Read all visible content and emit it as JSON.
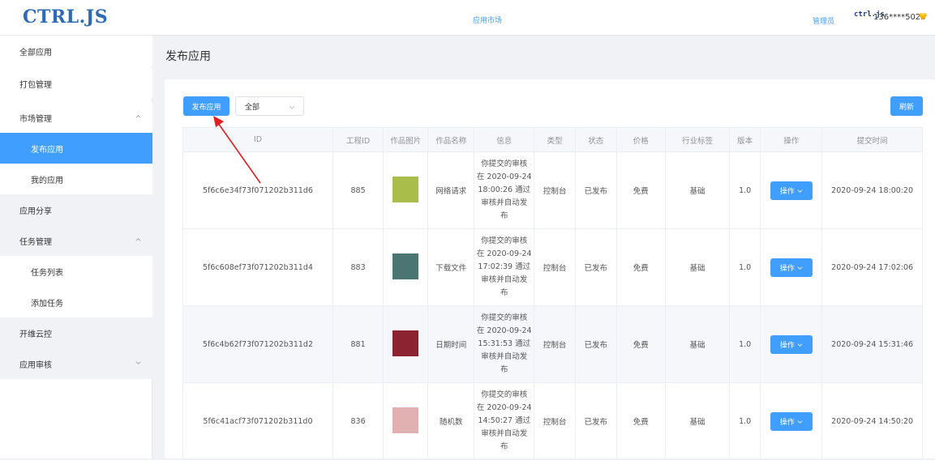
{
  "header": {
    "logo": "CTRL.JS",
    "nav_market": "应用市场",
    "admin": "管理员",
    "user_logo": "ctrl.js",
    "user_phone": "136****5023"
  },
  "icons": {
    "gem": "gem-icon",
    "chevron": "chevron-icon"
  },
  "colors": {
    "primary": "#409eff",
    "logo": "#2d6bb5",
    "arrow": "#e02020"
  },
  "sidebar": {
    "items": [
      {
        "label": "全部应用"
      },
      {
        "label": "打包管理"
      },
      {
        "label": "市场管理"
      },
      {
        "label": "发布应用"
      },
      {
        "label": "我的应用"
      },
      {
        "label": "应用分享"
      },
      {
        "label": "任务管理"
      },
      {
        "label": "任务列表"
      },
      {
        "label": "添加任务"
      },
      {
        "label": "开维云控"
      },
      {
        "label": "应用审核"
      }
    ]
  },
  "main": {
    "title": "发布应用",
    "publish_btn": "发布应用",
    "filter_value": "全部",
    "refresh_btn": "刷新"
  },
  "table": {
    "headers": [
      "ID",
      "工程ID",
      "作品图片",
      "作品名称",
      "信息",
      "类型",
      "状态",
      "价格",
      "行业标签",
      "版本",
      "操作",
      "提交时间"
    ],
    "rows": [
      {
        "id": "5f6c6e34f73f071202b311d6",
        "project_id": "885",
        "thumb_color": "#a8bd4a",
        "name": "网络请求",
        "info": [
          "你提交的审核",
          "在 2020-09-24",
          "18:00:26 通过",
          "审核并自动发",
          "布"
        ],
        "type": "控制台",
        "status": "已发布",
        "price": "免费",
        "tag": "基础",
        "version": "1.0",
        "op": "操作",
        "time": "2020-09-24 18:00:20"
      },
      {
        "id": "5f6c608ef73f071202b311d4",
        "project_id": "883",
        "thumb_color": "#4b7573",
        "name": "下载文件",
        "info": [
          "你提交的审核",
          "在 2020-09-24",
          "17:02:39 通过",
          "审核并自动发",
          "布"
        ],
        "type": "控制台",
        "status": "已发布",
        "price": "免费",
        "tag": "基础",
        "version": "1.0",
        "op": "操作",
        "time": "2020-09-24 17:02:06"
      },
      {
        "id": "5f6c4b62f73f071202b311d2",
        "project_id": "881",
        "thumb_color": "#8b2331",
        "name": "日期时间",
        "info": [
          "你提交的审核",
          "在 2020-09-24",
          "15:31:53 通过",
          "审核并自动发",
          "布"
        ],
        "type": "控制台",
        "status": "已发布",
        "price": "免费",
        "tag": "基础",
        "version": "1.0",
        "op": "操作",
        "time": "2020-09-24 15:31:46"
      },
      {
        "id": "5f6c41acf73f071202b311d0",
        "project_id": "836",
        "thumb_color": "#e0b1b0",
        "name": "随机数",
        "info": [
          "你提交的审核",
          "在 2020-09-24",
          "14:50:27 通过",
          "审核并自动发",
          "布"
        ],
        "type": "控制台",
        "status": "已发布",
        "price": "免费",
        "tag": "基础",
        "version": "1.0",
        "op": "操作",
        "time": "2020-09-24 14:50:20"
      }
    ]
  }
}
